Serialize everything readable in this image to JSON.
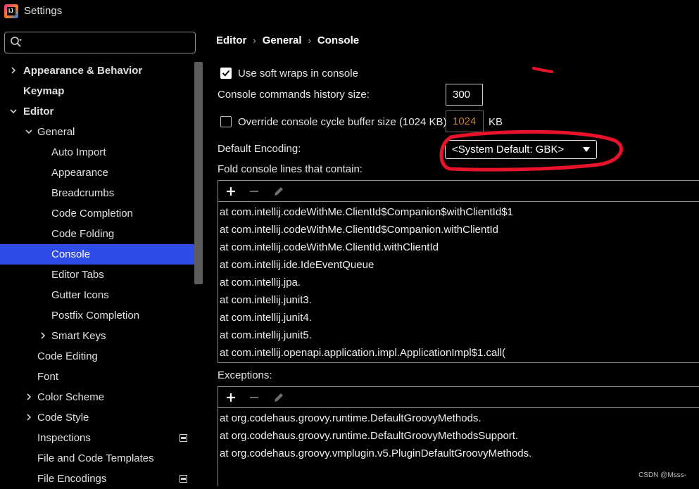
{
  "window": {
    "title": "Settings",
    "logo_text": "IJ"
  },
  "search": {
    "placeholder": "",
    "value": ""
  },
  "sidebar": {
    "items": [
      {
        "label": "Appearance & Behavior",
        "level": 0,
        "bold": true,
        "chevron": "right"
      },
      {
        "label": "Keymap",
        "level": 0,
        "bold": true,
        "chevron": ""
      },
      {
        "label": "Editor",
        "level": 0,
        "bold": true,
        "chevron": "down"
      },
      {
        "label": "General",
        "level": 1,
        "bold": false,
        "chevron": "down"
      },
      {
        "label": "Auto Import",
        "level": 2,
        "bold": false,
        "chevron": ""
      },
      {
        "label": "Appearance",
        "level": 2,
        "bold": false,
        "chevron": ""
      },
      {
        "label": "Breadcrumbs",
        "level": 2,
        "bold": false,
        "chevron": ""
      },
      {
        "label": "Code Completion",
        "level": 2,
        "bold": false,
        "chevron": ""
      },
      {
        "label": "Code Folding",
        "level": 2,
        "bold": false,
        "chevron": ""
      },
      {
        "label": "Console",
        "level": 2,
        "bold": false,
        "chevron": "",
        "selected": true
      },
      {
        "label": "Editor Tabs",
        "level": 2,
        "bold": false,
        "chevron": ""
      },
      {
        "label": "Gutter Icons",
        "level": 2,
        "bold": false,
        "chevron": ""
      },
      {
        "label": "Postfix Completion",
        "level": 2,
        "bold": false,
        "chevron": ""
      },
      {
        "label": "Smart Keys",
        "level": 2,
        "bold": false,
        "chevron": "right"
      },
      {
        "label": "Code Editing",
        "level": 1,
        "bold": false,
        "chevron": ""
      },
      {
        "label": "Font",
        "level": 1,
        "bold": false,
        "chevron": ""
      },
      {
        "label": "Color Scheme",
        "level": 1,
        "bold": false,
        "chevron": "right"
      },
      {
        "label": "Code Style",
        "level": 1,
        "bold": false,
        "chevron": "right"
      },
      {
        "label": "Inspections",
        "level": 1,
        "bold": false,
        "chevron": "",
        "badge": true
      },
      {
        "label": "File and Code Templates",
        "level": 1,
        "bold": false,
        "chevron": ""
      },
      {
        "label": "File Encodings",
        "level": 1,
        "bold": false,
        "chevron": "",
        "badge": true
      }
    ]
  },
  "breadcrumb": {
    "parts": [
      "Editor",
      "General",
      "Console"
    ],
    "separator": "›"
  },
  "settings": {
    "soft_wraps_label": "Use soft wraps in console",
    "soft_wraps_checked": true,
    "history_label": "Console commands history size:",
    "history_value": "300",
    "override_label": "Override console cycle buffer size (1024 KB)",
    "override_checked": false,
    "buffer_value": "1024",
    "buffer_unit": "KB",
    "encoding_label": "Default Encoding:",
    "encoding_value": "<System Default: GBK>",
    "fold_label": "Fold console lines that contain:",
    "exceptions_label": "Exceptions:"
  },
  "fold_lines": [
    "at com.intellij.codeWithMe.ClientId$Companion$withClientId$1",
    "at com.intellij.codeWithMe.ClientId$Companion.withClientId",
    "at com.intellij.codeWithMe.ClientId.withClientId",
    "at com.intellij.ide.IdeEventQueue",
    "at com.intellij.jpa.",
    "at com.intellij.junit3.",
    "at com.intellij.junit4.",
    "at com.intellij.junit5.",
    "at com.intellij.openapi.application.impl.ApplicationImpl$1.call("
  ],
  "exception_lines": [
    "at org.codehaus.groovy.runtime.DefaultGroovyMethods.",
    "at org.codehaus.groovy.runtime.DefaultGroovyMethodsSupport.",
    "at org.codehaus.groovy.vmplugin.v5.PluginDefaultGroovyMethods."
  ],
  "watermark": "CSDN @Msss-",
  "colors": {
    "selection": "#2f4de6",
    "annotation": "#e8122a",
    "disabled_value": "#c8822a"
  },
  "icons": {
    "add": "plus-icon",
    "remove": "minus-icon",
    "edit": "pencil-icon"
  }
}
